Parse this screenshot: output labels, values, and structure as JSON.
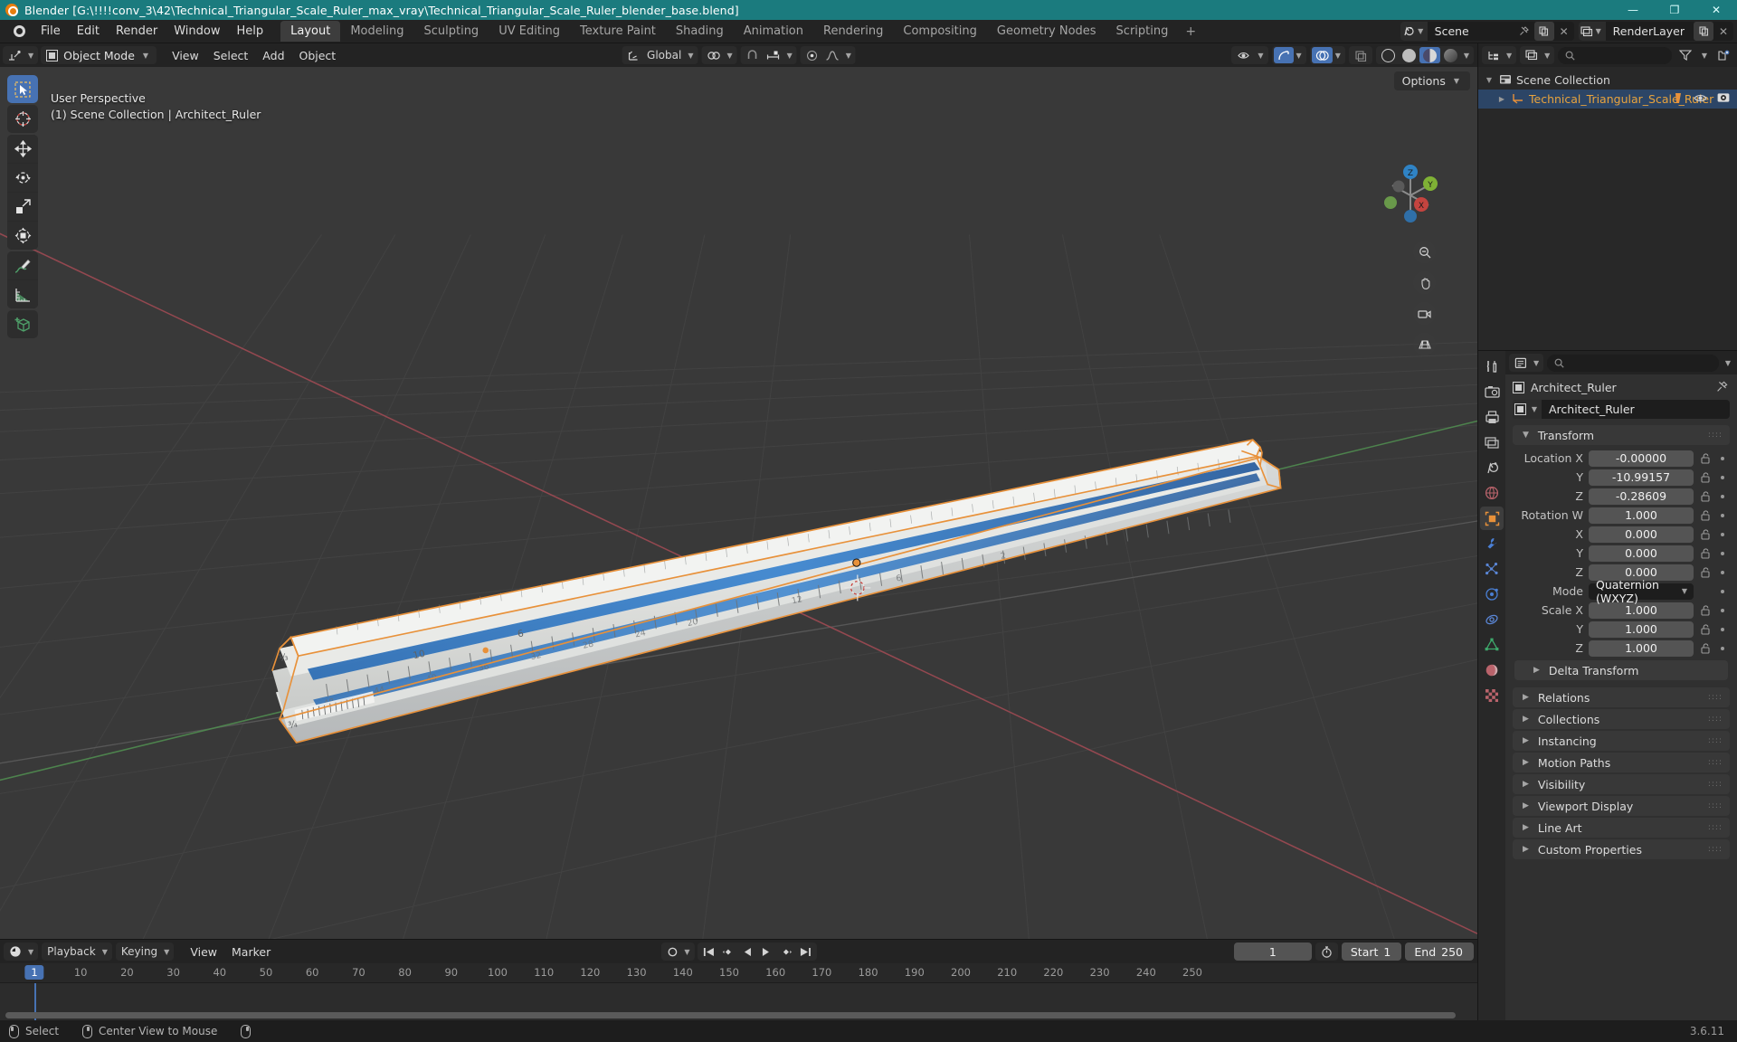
{
  "titlebar": {
    "title": "Blender [G:\\!!!!conv_3\\42\\Technical_Triangular_Scale_Ruler_max_vray\\Technical_Triangular_Scale_Ruler_blender_base.blend]",
    "minimize": "—",
    "maximize": "❐",
    "close": "✕"
  },
  "topbar": {
    "menus": [
      "File",
      "Edit",
      "Render",
      "Window",
      "Help"
    ],
    "workspaces": [
      "Layout",
      "Modeling",
      "Sculpting",
      "UV Editing",
      "Texture Paint",
      "Shading",
      "Animation",
      "Rendering",
      "Compositing",
      "Geometry Nodes",
      "Scripting"
    ],
    "active_workspace": "Layout",
    "add_workspace": "+",
    "scene_name": "Scene",
    "viewlayer_name": "RenderLayer"
  },
  "viewport_header": {
    "mode": "Object Mode",
    "menus": [
      "View",
      "Select",
      "Add",
      "Object"
    ],
    "orientation": "Global",
    "options_label": "Options"
  },
  "viewport": {
    "hud_line1": "User Perspective",
    "hud_line2": "(1) Scene Collection | Architect_Ruler",
    "gizmo_axes": [
      "X",
      "Y",
      "Z"
    ]
  },
  "tools": [
    "tweak-select-tool",
    "cursor-tool",
    "move-tool",
    "rotate-tool",
    "scale-tool",
    "transform-tool",
    "annotate-tool",
    "measure-tool",
    "add-cube-tool"
  ],
  "outliner": {
    "items": [
      {
        "label": "Scene Collection",
        "icon": "collection-icon",
        "selected": false,
        "indent": 0
      },
      {
        "label": "Technical_Triangular_Scale_Ruler",
        "icon": "empty-axes-icon",
        "selected": true,
        "indent": 1
      }
    ]
  },
  "properties": {
    "tabs": [
      "tool-tab",
      "render-tab",
      "output-tab",
      "view-layer-tab",
      "scene-tab",
      "world-tab",
      "object-tab",
      "modifier-tab",
      "particles-tab",
      "physics-tab",
      "constraints-tab",
      "data-tab",
      "material-tab",
      "texture-tab"
    ],
    "active_tab": "object-tab",
    "breadcrumb": "Architect_Ruler",
    "object_name": "Architect_Ruler",
    "transform": {
      "title": "Transform",
      "rows": [
        {
          "label": "Location X",
          "value": "-0.00000"
        },
        {
          "label": "Y",
          "value": "-10.99157"
        },
        {
          "label": "Z",
          "value": "-0.28609"
        },
        {
          "label": "Rotation W",
          "value": "1.000"
        },
        {
          "label": "X",
          "value": "0.000"
        },
        {
          "label": "Y",
          "value": "0.000"
        },
        {
          "label": "Z",
          "value": "0.000"
        }
      ],
      "mode_label": "Mode",
      "mode_value": "Quaternion (WXYZ)",
      "scale_rows": [
        {
          "label": "Scale X",
          "value": "1.000"
        },
        {
          "label": "Y",
          "value": "1.000"
        },
        {
          "label": "Z",
          "value": "1.000"
        }
      ],
      "delta_transform": "Delta Transform"
    },
    "panels": [
      "Relations",
      "Collections",
      "Instancing",
      "Motion Paths",
      "Visibility",
      "Viewport Display",
      "Line Art",
      "Custom Properties"
    ]
  },
  "timeline": {
    "menus": [
      "Playback",
      "Keying",
      "View",
      "Marker"
    ],
    "current_frame": "1",
    "start_label": "Start",
    "start_value": "1",
    "end_label": "End",
    "end_value": "250",
    "ticks": [
      "1",
      "10",
      "20",
      "30",
      "40",
      "50",
      "60",
      "70",
      "80",
      "90",
      "100",
      "110",
      "120",
      "130",
      "140",
      "150",
      "160",
      "170",
      "180",
      "190",
      "200",
      "210",
      "220",
      "230",
      "240",
      "250"
    ]
  },
  "status": {
    "select": "Select",
    "center_view": "Center View to Mouse",
    "version": "3.6.11"
  },
  "colors": {
    "accent_blue": "#4772b3",
    "select_orange": "#e8a33d",
    "titlebar_teal": "#1b7b7e",
    "viewport_bg": "#393939"
  }
}
